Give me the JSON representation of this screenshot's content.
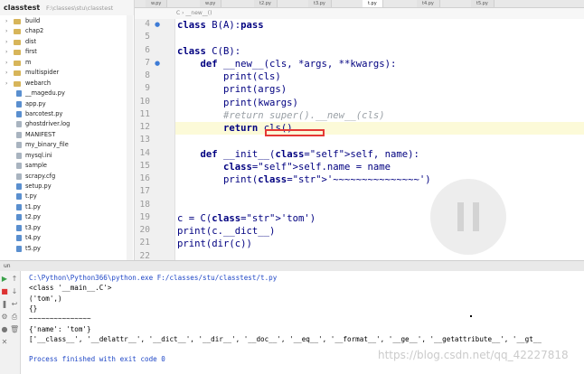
{
  "project": {
    "root_name": "classtest",
    "root_path": "F:\\classes\\stu\\classtest",
    "items": [
      {
        "type": "folder",
        "label": "build"
      },
      {
        "type": "folder",
        "label": "chap2"
      },
      {
        "type": "folder",
        "label": "dist"
      },
      {
        "type": "folder",
        "label": "first"
      },
      {
        "type": "folder",
        "label": "m"
      },
      {
        "type": "folder",
        "label": "multispider"
      },
      {
        "type": "folder",
        "label": "webarch"
      },
      {
        "type": "py",
        "label": "__magedu.py"
      },
      {
        "type": "py",
        "label": "app.py"
      },
      {
        "type": "py",
        "label": "barcotest.py"
      },
      {
        "type": "txt",
        "label": "ghostdriver.log"
      },
      {
        "type": "txt",
        "label": "MANIFEST"
      },
      {
        "type": "txt",
        "label": "my_binary_file"
      },
      {
        "type": "txt",
        "label": "mysql.ini"
      },
      {
        "type": "txt",
        "label": "sample"
      },
      {
        "type": "txt",
        "label": "scrapy.cfg"
      },
      {
        "type": "py",
        "label": "setup.py"
      },
      {
        "type": "py",
        "label": "t.py"
      },
      {
        "type": "py",
        "label": "t1.py"
      },
      {
        "type": "py",
        "label": "t2.py"
      },
      {
        "type": "py",
        "label": "t3.py"
      },
      {
        "type": "py",
        "label": "t4.py"
      },
      {
        "type": "py",
        "label": "t5.py"
      }
    ]
  },
  "editor": {
    "tabs": [
      {
        "label": "w.py"
      },
      {
        "label": "w.py"
      },
      {
        "label": "t2.py"
      },
      {
        "label": "t3.py"
      },
      {
        "label": "t.py"
      },
      {
        "label": "t4.py"
      },
      {
        "label": "t5.py"
      }
    ],
    "breadcrumb": "C  ›  __new__()",
    "lines": [
      {
        "num": "4",
        "text": "class B(A):pass"
      },
      {
        "num": "5",
        "text": ""
      },
      {
        "num": "6",
        "text": "class C(B):"
      },
      {
        "num": "7",
        "text": "    def __new__(cls, *args, **kwargs):"
      },
      {
        "num": "8",
        "text": "        print(cls)"
      },
      {
        "num": "9",
        "text": "        print(args)"
      },
      {
        "num": "10",
        "text": "        print(kwargs)"
      },
      {
        "num": "11",
        "text": "        #return super().__new__(cls)"
      },
      {
        "num": "12",
        "text": "        return cls()"
      },
      {
        "num": "13",
        "text": ""
      },
      {
        "num": "14",
        "text": "    def __init__(self, name):"
      },
      {
        "num": "15",
        "text": "        self.name = name"
      },
      {
        "num": "16",
        "text": "        print('~~~~~~~~~~~~~~~')"
      },
      {
        "num": "17",
        "text": ""
      },
      {
        "num": "18",
        "text": ""
      },
      {
        "num": "19",
        "text": "c = C('tom')"
      },
      {
        "num": "20",
        "text": "print(c.__dict__)"
      },
      {
        "num": "21",
        "text": "print(dir(c))"
      },
      {
        "num": "22",
        "text": ""
      }
    ]
  },
  "run": {
    "header": "un",
    "output": [
      {
        "kind": "cmd",
        "text": "C:\\Python\\Python366\\python.exe F:/classes/stu/classtest/t.py"
      },
      {
        "kind": "out",
        "text": "<class '__main__.C'>"
      },
      {
        "kind": "out",
        "text": "('tom',)"
      },
      {
        "kind": "out",
        "text": "{}"
      },
      {
        "kind": "out",
        "text": "~~~~~~~~~~~~~~~"
      },
      {
        "kind": "out",
        "text": "{'name': 'tom'}"
      },
      {
        "kind": "out",
        "text": "['__class__', '__delattr__', '__dict__', '__dir__', '__doc__', '__eq__', '__format__', '__ge__', '__getattribute__', '__gt__"
      },
      {
        "kind": "blank",
        "text": ""
      },
      {
        "kind": "fin",
        "text": "Process finished with exit code 0"
      }
    ]
  },
  "watermark": "https://blog.csdn.net/qq_42227818",
  "colors": {
    "keyword": "#000080",
    "string": "#008000",
    "comment": "#9aa0a6",
    "console_blue": "#1f47c6",
    "highlight_box": "#e53935"
  }
}
